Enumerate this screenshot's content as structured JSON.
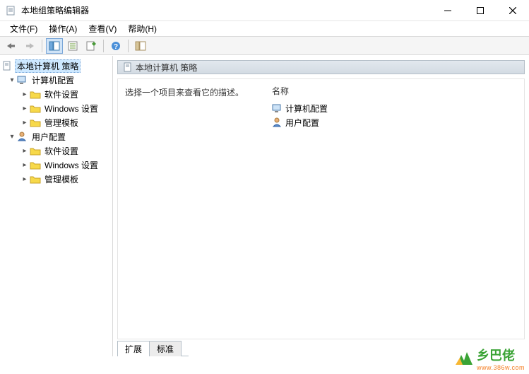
{
  "window": {
    "title": "本地组策略编辑器"
  },
  "menu": {
    "file": "文件(F)",
    "action": "操作(A)",
    "view": "查看(V)",
    "help": "帮助(H)"
  },
  "tree": {
    "root": "本地计算机 策略",
    "computer": "计算机配置",
    "user": "用户配置",
    "soft": "软件设置",
    "win": "Windows 设置",
    "admin": "管理模板"
  },
  "content": {
    "header": "本地计算机 策略",
    "description": "选择一个项目来查看它的描述。",
    "column_name": "名称",
    "item_computer": "计算机配置",
    "item_user": "用户配置"
  },
  "tabs": {
    "extended": "扩展",
    "standard": "标准"
  },
  "watermark": {
    "brand": "乡巴佬",
    "url": "www.386w.com"
  }
}
